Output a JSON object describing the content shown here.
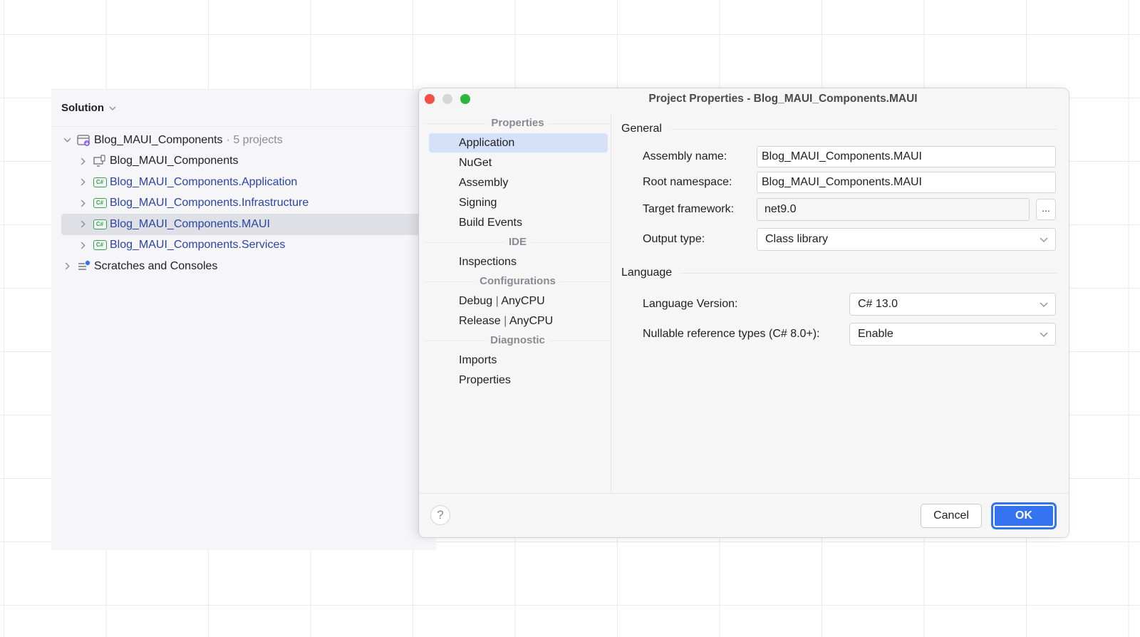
{
  "solution_panel": {
    "title": "Solution",
    "tree": [
      {
        "label": "Blog_MAUI_Components",
        "suffix": "· 5 projects",
        "kind": "solution",
        "expanded": true,
        "selected": false
      },
      {
        "label": "Blog_MAUI_Components",
        "kind": "shared-project",
        "expanded": false,
        "selected": false
      },
      {
        "label": "Blog_MAUI_Components.Application",
        "kind": "csharp-project",
        "expanded": false,
        "selected": false
      },
      {
        "label": "Blog_MAUI_Components.Infrastructure",
        "kind": "csharp-project",
        "expanded": false,
        "selected": false
      },
      {
        "label": "Blog_MAUI_Components.MAUI",
        "kind": "csharp-project",
        "expanded": false,
        "selected": true
      },
      {
        "label": "Blog_MAUI_Components.Services",
        "kind": "csharp-project",
        "expanded": false,
        "selected": false
      },
      {
        "label": "Scratches and Consoles",
        "kind": "scratches",
        "expanded": false,
        "selected": false
      }
    ],
    "cs_badge": "C#"
  },
  "dialog": {
    "title": "Project Properties - Blog_MAUI_Components.MAUI",
    "nav": {
      "sections": [
        {
          "title": "Properties",
          "items": [
            "Application",
            "NuGet",
            "Assembly",
            "Signing",
            "Build Events"
          ]
        },
        {
          "title": "IDE",
          "items": [
            "Inspections"
          ]
        },
        {
          "title": "Configurations",
          "items": [
            "Debug",
            "Release"
          ]
        },
        {
          "title": "Diagnostic",
          "items": [
            "Imports",
            "Properties"
          ]
        }
      ],
      "config_platform": "AnyCPU",
      "config_separator": "|",
      "active_item": "Application"
    },
    "general": {
      "title": "General",
      "assembly_name_label": "Assembly name:",
      "assembly_name_value": "Blog_MAUI_Components.MAUI",
      "root_namespace_label": "Root namespace:",
      "root_namespace_value": "Blog_MAUI_Components.MAUI",
      "target_framework_label": "Target framework:",
      "target_framework_value": "net9.0",
      "browse_label": "...",
      "output_type_label": "Output type:",
      "output_type_value": "Class library"
    },
    "language": {
      "title": "Language",
      "language_version_label": "Language Version:",
      "language_version_value": "C# 13.0",
      "nullable_label": "Nullable reference types (C# 8.0+):",
      "nullable_value": "Enable"
    },
    "footer": {
      "help_label": "?",
      "cancel_label": "Cancel",
      "ok_label": "OK"
    }
  },
  "colors": {
    "accent": "#3574f0",
    "selection": "#d5e1f8",
    "project_link": "#2a44a8",
    "cs_icon": "#3f9b57",
    "close": "#f4504b",
    "zoom": "#29b73f"
  }
}
